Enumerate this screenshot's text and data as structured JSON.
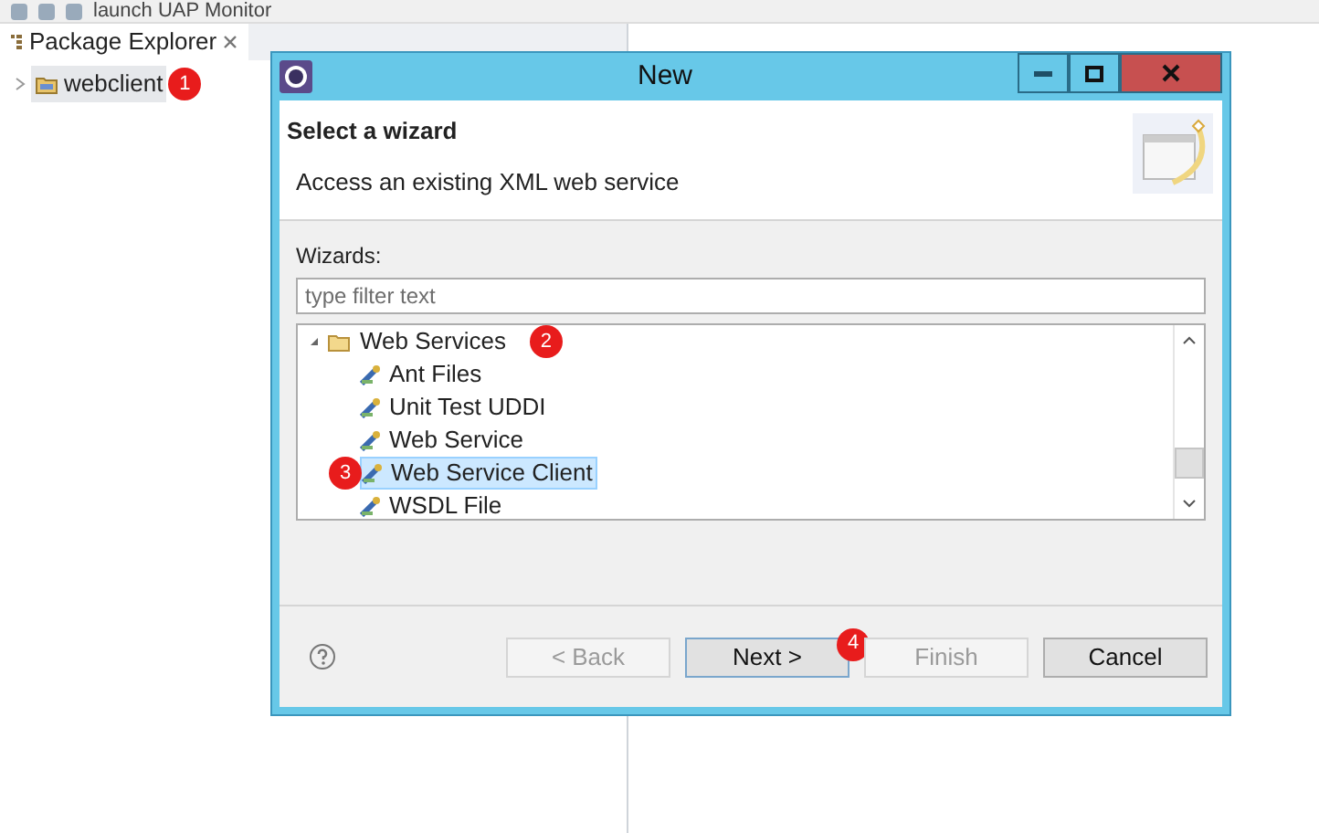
{
  "explorer": {
    "toolbar_text": "launch UAP Monitor",
    "tab_label": "Package Explorer",
    "tree": [
      {
        "label": "webclient",
        "selected": true,
        "marker": "1"
      }
    ]
  },
  "dialog": {
    "title": "New",
    "heading": "Select a wizard",
    "description": "Access an existing XML web service",
    "wizards_label": "Wizards:",
    "filter": {
      "placeholder": "type filter text"
    },
    "tree": [
      {
        "label": "Web Services",
        "expanded": true,
        "selected": false,
        "marker": "2",
        "children": [
          {
            "label": "Ant Files",
            "selected": false
          },
          {
            "label": "Unit Test UDDI",
            "selected": false
          },
          {
            "label": "Web Service",
            "selected": false
          },
          {
            "label": "Web Service Client",
            "selected": true,
            "marker": "3"
          },
          {
            "label": "WSDL File",
            "selected": false
          }
        ]
      }
    ],
    "buttons": [
      {
        "label": "< Back",
        "disabled": true,
        "default": false
      },
      {
        "label": "Next >",
        "disabled": false,
        "default": true,
        "marker": "4"
      },
      {
        "label": "Finish",
        "disabled": true,
        "default": false
      },
      {
        "label": "Cancel",
        "disabled": false,
        "default": false
      }
    ]
  }
}
